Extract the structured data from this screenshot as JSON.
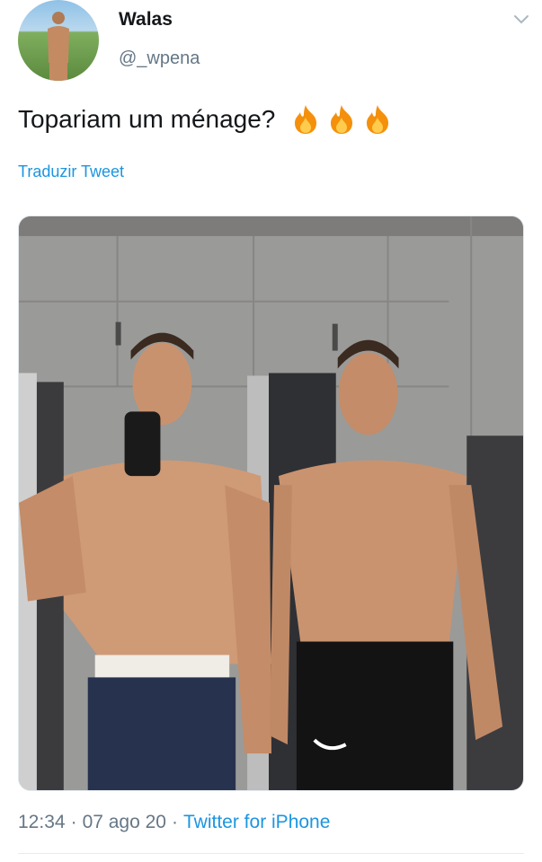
{
  "tweet": {
    "author_name": "Walas",
    "author_handle": "@_wpena",
    "text": "Topariam um ménage?",
    "emoji": [
      "fire-emoji",
      "fire-emoji",
      "fire-emoji"
    ],
    "translate_label": "Traduzir Tweet",
    "time": "12:34",
    "separator": "·",
    "date": "07 ago 20",
    "source": "Twitter for iPhone"
  },
  "colors": {
    "link": "#1b95e0",
    "secondary_text": "#657786",
    "primary_text": "#14171a",
    "divider": "#e6ecf0"
  },
  "icons": {
    "menu": "chevron-down-icon",
    "emoji": "fire-emoji"
  }
}
